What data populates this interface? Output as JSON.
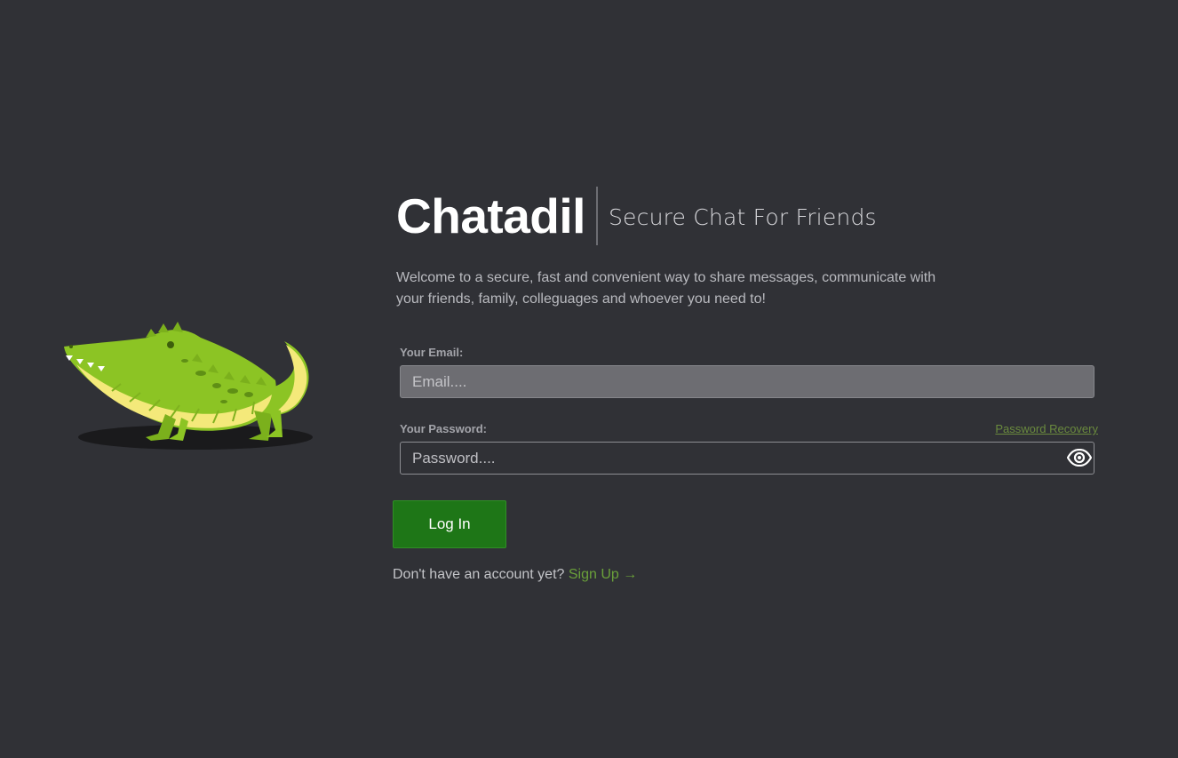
{
  "brand": {
    "name": "Chatadil",
    "tagline": "Secure Chat For Friends"
  },
  "welcome_text": "Welcome to a secure, fast and convenient way to share messages, communicate with your friends, family, colleguages and whoever you need to!",
  "form": {
    "email_label": "Your Email:",
    "email_placeholder": "Email....",
    "email_value": "",
    "password_label": "Your Password:",
    "password_placeholder": "Password....",
    "password_value": "",
    "recovery_link": "Password Recovery",
    "login_button": "Log In"
  },
  "signup": {
    "prompt": "Don't have an account yet?",
    "link": "Sign Up →"
  },
  "icons": {
    "mascot": "crocodile-mascot",
    "show_password": "eye-icon"
  },
  "colors": {
    "background": "#303136",
    "accent_green": "#6aa03a",
    "button_green": "#1e7617",
    "email_field_bg": "#6d6d72"
  }
}
